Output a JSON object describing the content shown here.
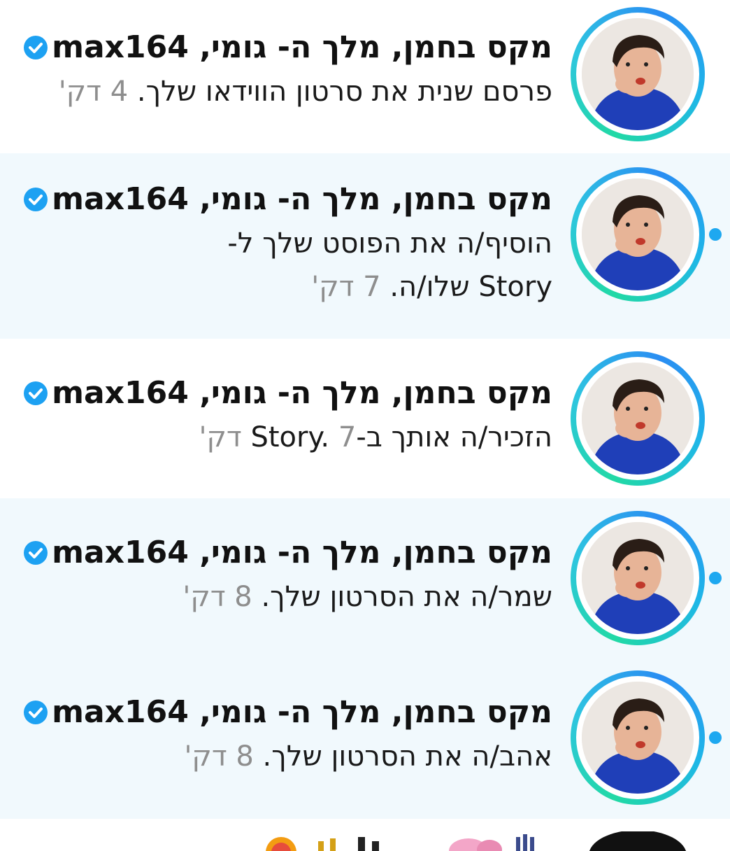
{
  "notifications": [
    {
      "display_name": "מקס בחמן, מלך ה- גומי,",
      "username": "max164",
      "action": "פרסם שנית את סרטון הווידאו שלך.",
      "time": "4 דק'",
      "unread": false
    },
    {
      "display_name": "מקס בחמן, מלך ה- גומי,",
      "username": "max164",
      "action": "הוסיף/ה את הפוסט שלך ל-Story שלו/ה.",
      "time": "7 דק'",
      "unread": true
    },
    {
      "display_name": "מקס בחמן, מלך ה- גומי,",
      "username": "max164",
      "action": "הזכיר/ה אותך ב-Story.",
      "time": "7 דק'",
      "unread": false
    },
    {
      "display_name": "מקס בחמן, מלך ה- גומי,",
      "username": "max164",
      "action": "שמר/ה את הסרטון שלך.",
      "time": "8 דק'",
      "unread": true
    },
    {
      "display_name": "מקס בחמן, מלך ה- גומי,",
      "username": "max164",
      "action": "אהב/ה את הסרטון שלך.",
      "time": "8 דק'",
      "unread": true
    }
  ],
  "colors": {
    "unread_background": "#f1f9fd",
    "ring_gradient": [
      "#21d9a5",
      "#2ec5e0",
      "#2a8df2"
    ],
    "verified_badge": "#1da1f2",
    "unread_dot": "#1ea8f0",
    "time_text": "#8e8e8e"
  },
  "icons": {
    "verified": "verified-badge-icon",
    "unread": "unread-dot-icon"
  }
}
